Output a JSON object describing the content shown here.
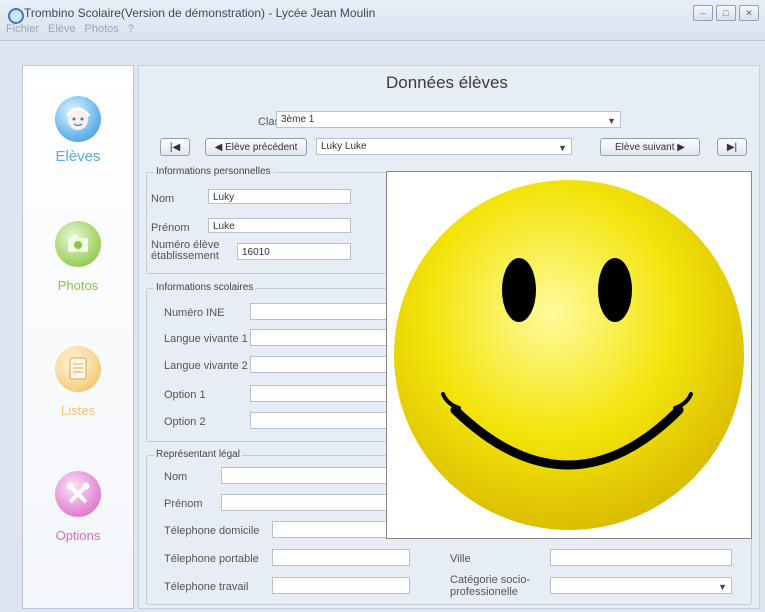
{
  "window": {
    "title": "Trombino Scolaire(Version de démonstration) - Lycée Jean Moulin",
    "minimize": "–",
    "maximize": "□",
    "close": "✕"
  },
  "menu": [
    "Fichier",
    "Elève",
    "Photos",
    "?"
  ],
  "sidebar": {
    "items": [
      {
        "label": "Elèves",
        "color": "#5aaae0"
      },
      {
        "label": "Photos",
        "color": "#8cc63f"
      },
      {
        "label": "Listes",
        "color": "#f5c46b"
      },
      {
        "label": "Options",
        "color": "#d86ac8"
      }
    ]
  },
  "main": {
    "heading": "Données élèves",
    "classe_label": "Classe",
    "classe_value": "3ème 1",
    "first_btn": "|◀",
    "prev_btn": "◀  Elève précédent",
    "student_select": "Luky Luke",
    "next_btn": "Elève suivant  ▶",
    "last_btn": "▶|"
  },
  "personal": {
    "title": "Informations personnelles",
    "nom_label": "Nom",
    "nom_value": "Luky",
    "prenom_label": "Prénom",
    "prenom_value": "Luke",
    "numero_label_1": "Numéro élève",
    "numero_label_2": "établissement",
    "numero_value": "16010"
  },
  "scolaire": {
    "title": "Informations scolaires",
    "fields": [
      "Numéro INE",
      "Langue vivante 1",
      "Langue vivante 2",
      "Option 1",
      "Option 2"
    ]
  },
  "legal": {
    "title": "Représentant légal",
    "nom": "Nom",
    "prenom": "Prénom",
    "tel_domicile": "Télephone domicile",
    "tel_portable": "Télephone portable",
    "tel_travail": "Télephone travail",
    "ville": "Ville",
    "categorie_1": "Catégorie socio-",
    "categorie_2": "professionelle"
  },
  "colors": {
    "accent": "#3b79c2",
    "smiley": "#f3e40a"
  }
}
